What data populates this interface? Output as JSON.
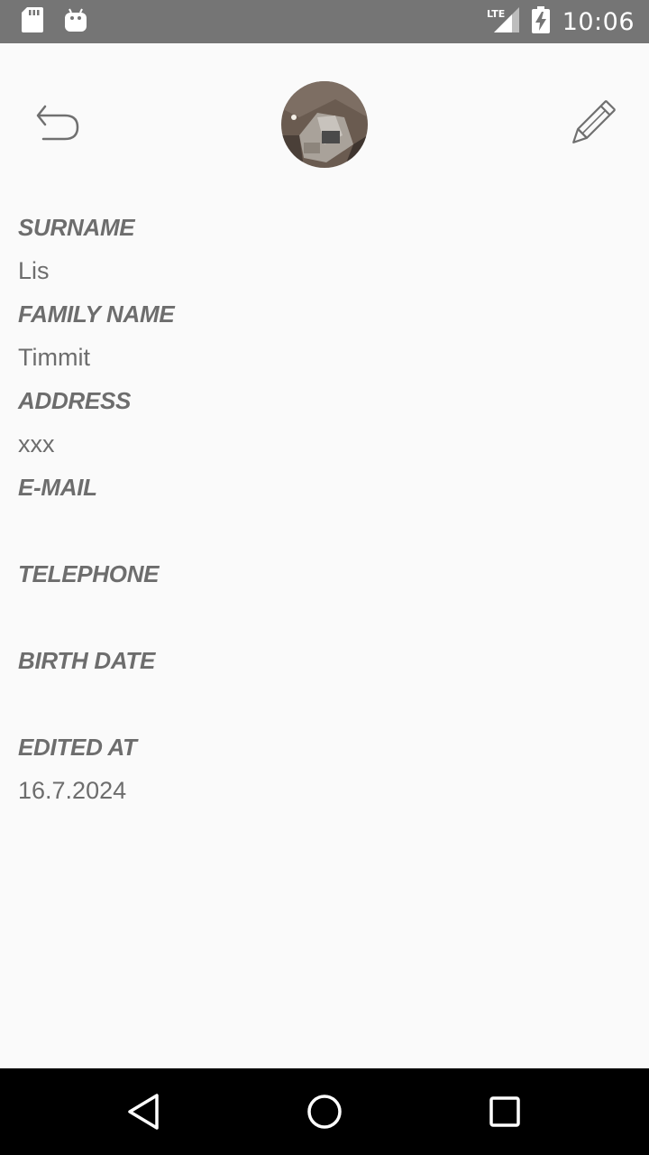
{
  "status_bar": {
    "time": "10:06",
    "network": "LTE",
    "icons": [
      "sd-card-icon",
      "android-icon",
      "lte-signal-icon",
      "battery-charging-icon"
    ]
  },
  "header": {
    "back_icon": "undo-arrow-icon",
    "edit_icon": "pencil-icon",
    "avatar": "contact-photo"
  },
  "fields": [
    {
      "label": "SURNAME",
      "value": "Lis"
    },
    {
      "label": "FAMILY NAME",
      "value": "Timmit"
    },
    {
      "label": "ADDRESS",
      "value": "xxx"
    },
    {
      "label": "E-MAIL",
      "value": ""
    },
    {
      "label": "TELEPHONE",
      "value": ""
    },
    {
      "label": "BIRTH DATE",
      "value": ""
    },
    {
      "label": "EDITED AT",
      "value": "16.7.2024"
    }
  ],
  "nav_bar": {
    "buttons": [
      "back-triangle-icon",
      "home-circle-icon",
      "recents-square-icon"
    ]
  },
  "colors": {
    "status_bar": "#757575",
    "background": "#fafafa",
    "text": "#6d6d6d",
    "nav_bar": "#000000"
  }
}
